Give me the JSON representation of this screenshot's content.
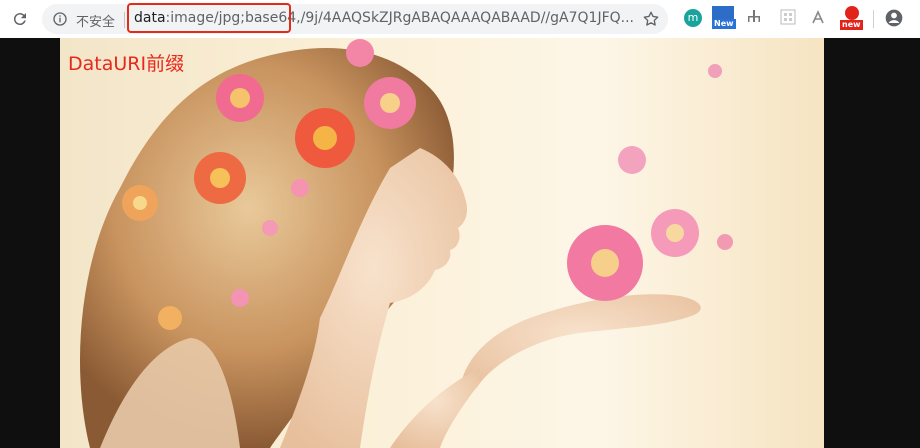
{
  "browser": {
    "security_label": "不安全",
    "url_scheme": "data",
    "url_rest": ":image/jpg;base64,/9j/4AAQSkZJRgABAQAAAQABAAD//gA7Q1JFQ...",
    "extensions": [
      {
        "icon": "m-icon",
        "label": "m"
      },
      {
        "icon": "new-badge-icon",
        "label": "New"
      },
      {
        "icon": "tree-icon"
      },
      {
        "icon": "grid-icon"
      },
      {
        "icon": "pdf-icon"
      },
      {
        "icon": "new-red-badge-icon",
        "label": "new"
      }
    ]
  },
  "page": {
    "caption": "DataURI前缀"
  },
  "colors": {
    "accent_red": "#e32b17",
    "caption_red": "#e8281c",
    "omnibox_bg": "#f1f3f4"
  }
}
